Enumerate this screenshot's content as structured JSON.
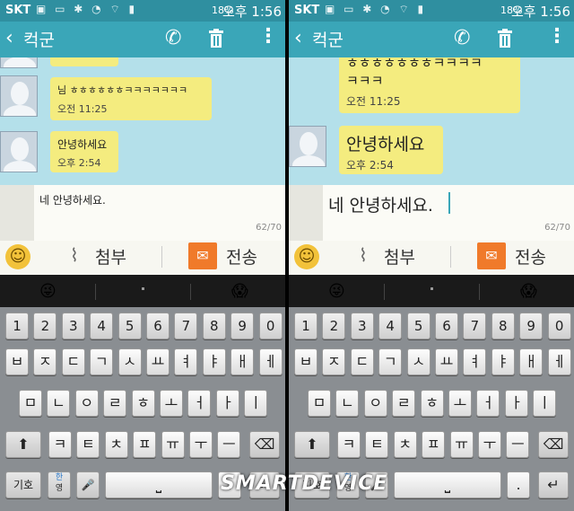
{
  "status": {
    "carrier": "SKT",
    "battery": "18%",
    "time": "오후 1:56"
  },
  "contact": "컥군",
  "screens": [
    {
      "messages": [
        {
          "text": "님 ㅎㅎㅎㅎㅎㅎㅋㅋㅋㅋㅋㅋㅋ",
          "time": "오전 11:25"
        },
        {
          "text": "안녕하세요",
          "time": "오후 2:54"
        }
      ],
      "compose": {
        "text": "네 안녕하세요.",
        "count": "62/70"
      }
    },
    {
      "messages": [
        {
          "text": "ㅎㅎㅎㅎㅎㅎㅎㅋㅋㅋㅋ\nㅋㅋㅋ",
          "time": "오전 11:25"
        },
        {
          "text": "안녕하세요",
          "time": "오후 2:54"
        }
      ],
      "compose": {
        "text": "네 안녕하세요.",
        "count": "62/70"
      }
    }
  ],
  "actions": {
    "attach": "첨부",
    "send": "전송"
  },
  "suggestions": [
    "😜",
    ".",
    "😱"
  ],
  "keyboard": {
    "numbers": [
      "1",
      "2",
      "3",
      "4",
      "5",
      "6",
      "7",
      "8",
      "9",
      "0"
    ],
    "row1": [
      "ㅂ",
      "ㅈ",
      "ㄷ",
      "ㄱ",
      "ㅅ",
      "ㅛ",
      "ㅕ",
      "ㅑ",
      "ㅐ",
      "ㅔ"
    ],
    "row2": [
      "ㅁ",
      "ㄴ",
      "ㅇ",
      "ㄹ",
      "ㅎ",
      "ㅗ",
      "ㅓ",
      "ㅏ",
      "ㅣ"
    ],
    "row3": [
      "ㅋ",
      "ㅌ",
      "ㅊ",
      "ㅍ",
      "ㅠ",
      "ㅜ",
      "ㅡ"
    ],
    "symbols": "기호",
    "lang_top": "한",
    "lang_bottom": "영",
    "period": ".",
    "extra": "?"
  },
  "watermark": "SMARTDEVICE",
  "colors": {
    "status_bar": "#2f8fa0",
    "action_bar": "#3aa6b8",
    "chat_bg": "#b4e0ea",
    "bubble": "#f4ec7f",
    "send": "#f07a2a"
  }
}
